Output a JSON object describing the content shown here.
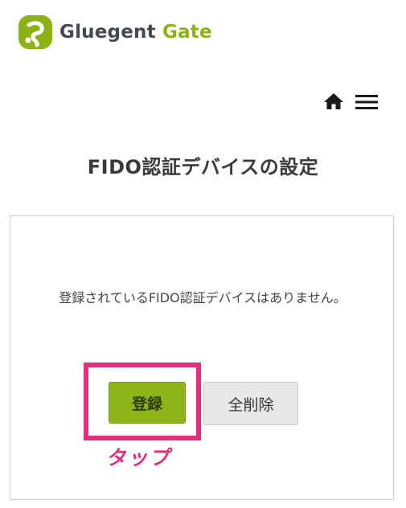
{
  "header": {
    "logo_text_primary": "Gluegent",
    "logo_text_accent": "Gate",
    "brand_color": "#8bb315",
    "icons": [
      "logo-icon",
      "home-icon",
      "hamburger-menu-icon"
    ]
  },
  "main": {
    "title": "FIDO認証デバイスの設定",
    "message": "登録されているFIDO認証デバイスはありません。",
    "buttons": {
      "register_label": "登録",
      "delete_all_label": "全削除"
    }
  },
  "annotation": {
    "tap_label": "タップ",
    "highlight_color": "#e2307f"
  }
}
